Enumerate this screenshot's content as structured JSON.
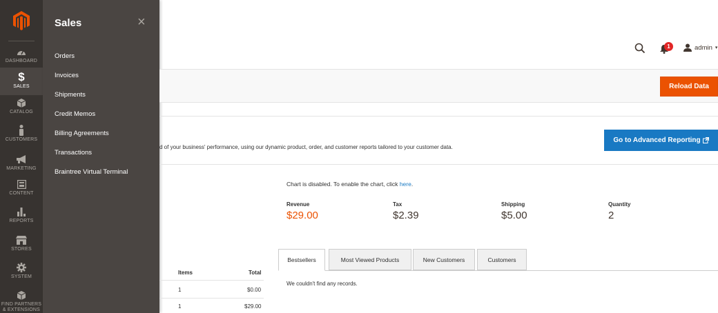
{
  "sidebar": {
    "items": [
      {
        "label": "DASHBOARD",
        "icon": "dashboard-gauge-icon"
      },
      {
        "label": "SALES",
        "icon": "dollar-icon"
      },
      {
        "label": "CATALOG",
        "icon": "catalog-box-icon"
      },
      {
        "label": "CUSTOMERS",
        "icon": "customers-person-icon"
      },
      {
        "label": "MARKETING",
        "icon": "marketing-megaphone-icon"
      },
      {
        "label": "CONTENT",
        "icon": "content-layout-icon"
      },
      {
        "label": "REPORTS",
        "icon": "reports-bars-icon"
      },
      {
        "label": "STORES",
        "icon": "stores-shop-icon"
      },
      {
        "label": "SYSTEM",
        "icon": "system-gear-icon"
      },
      {
        "label_line1": "FIND PARTNERS",
        "label_line2": "& EXTENSIONS",
        "icon": "partners-box-icon"
      }
    ]
  },
  "flyout": {
    "title": "Sales",
    "close_glyph": "×",
    "items": [
      "Orders",
      "Invoices",
      "Shipments",
      "Credit Memos",
      "Billing Agreements",
      "Transactions",
      "Braintree Virtual Terminal"
    ]
  },
  "header": {
    "notification_count": "1",
    "user_name": "admin"
  },
  "actions": {
    "reload_label": "Reload Data"
  },
  "advanced": {
    "text": "d of your business' performance, using our dynamic product, order, and customer reports tailored to your customer data.",
    "button_label": "Go to Advanced Reporting"
  },
  "chart": {
    "message": "Chart is disabled. To enable the chart, click",
    "link": "here",
    "period": "."
  },
  "metrics": [
    {
      "label": "Revenue",
      "value": "$29.00"
    },
    {
      "label": "Tax",
      "value": "$2.39"
    },
    {
      "label": "Shipping",
      "value": "$5.00"
    },
    {
      "label": "Quantity",
      "value": "2"
    }
  ],
  "orders_table": {
    "headers": {
      "items": "Items",
      "total": "Total"
    },
    "rows": [
      {
        "items": "1",
        "total": "$0.00"
      },
      {
        "items": "1",
        "total": "$29.00"
      }
    ]
  },
  "tabs": {
    "items": [
      "Bestsellers",
      "Most Viewed Products",
      "New Customers",
      "Customers"
    ],
    "empty_message": "We couldn't find any records."
  },
  "colors": {
    "sidebar": "#373330",
    "flyout": "#4a4542",
    "accent_orange": "#eb5202",
    "accent_blue": "#1979c3"
  }
}
